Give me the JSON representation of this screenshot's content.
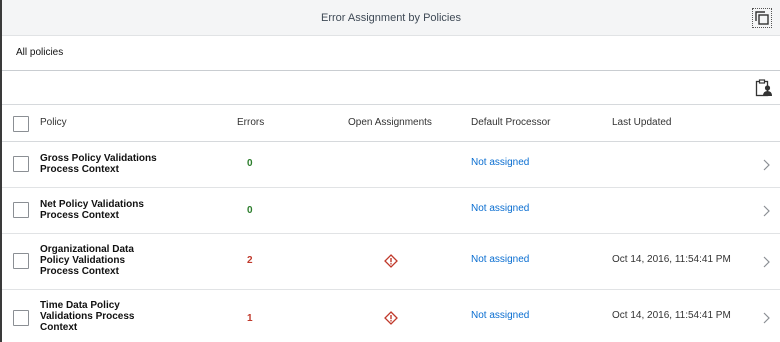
{
  "window": {
    "title": "Error Assignment by Policies"
  },
  "scope": {
    "label": "All policies"
  },
  "table": {
    "headers": {
      "policy": "Policy",
      "errors": "Errors",
      "open_assignments": "Open Assignments",
      "default_processor": "Default Processor",
      "last_updated": "Last Updated"
    },
    "rows": [
      {
        "policy": [
          "Gross Policy Validations",
          "Process Context"
        ],
        "errors": "0",
        "open_assignment_icon": "",
        "processor": "Not assigned",
        "last_updated": ""
      },
      {
        "policy": [
          "Net Policy Validations",
          "Process Context"
        ],
        "errors": "0",
        "open_assignment_icon": "",
        "processor": "Not assigned",
        "last_updated": ""
      },
      {
        "policy": [
          "Organizational Data",
          "Policy Validations",
          "Process Context"
        ],
        "errors": "2",
        "open_assignment_icon": "warning-diamond-icon",
        "processor": "Not assigned",
        "last_updated": "Oct 14, 2016, 11:54:41 PM"
      },
      {
        "policy": [
          "Time Data Policy",
          "Validations Process",
          "Context"
        ],
        "errors": "1",
        "open_assignment_icon": "warning-diamond-icon",
        "processor": "Not assigned",
        "last_updated": "Oct 14, 2016, 11:54:41 PM"
      }
    ]
  },
  "icons": {
    "fullscreen": "fullscreen-icon",
    "assign": "assign-person-icon",
    "row_nav": "chevron-right-icon"
  },
  "colors": {
    "errors_ok": "#2b7d2b",
    "errors_bad": "#c0392b",
    "link": "#0a6ed1",
    "warning": "#c0392b"
  }
}
